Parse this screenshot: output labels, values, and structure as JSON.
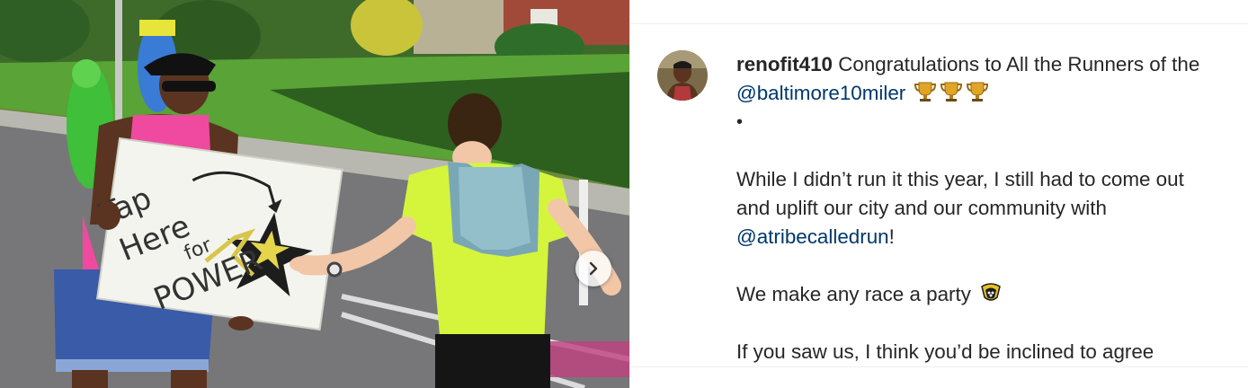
{
  "post": {
    "username": "renofit410",
    "caption_line1_text": " Congratulations to All the Runners of the ",
    "mention_1": "@baltimore10miler",
    "bullet": "•",
    "paragraph_2_text": "While I didn’t run it this year, I still had to come out and uplift our city and our community with ",
    "mention_2": "@atribecalledrun",
    "paragraph_2_end": "!",
    "paragraph_3_text": "We make any race a party ",
    "paragraph_4_text": "If you saw us, I think you’d be inclined to agree"
  },
  "media": {
    "sign_lines": [
      "Tap",
      "Here",
      "for",
      "POWER"
    ],
    "next_icon": "chevron-right-icon"
  },
  "icons": {
    "trophy": "trophy-icon",
    "party": "party-emoji-icon"
  },
  "colors": {
    "mention": "#00376b",
    "text": "#262626",
    "shirt_yellow": "#d4f53c"
  }
}
